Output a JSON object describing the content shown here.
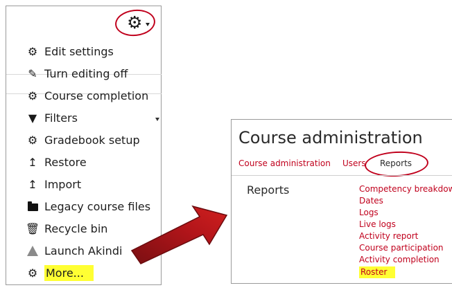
{
  "menu": {
    "gear_icon": "gear-icon",
    "items": [
      {
        "label": "Edit settings",
        "icon": "gear-icon"
      },
      {
        "label": "Turn editing off",
        "icon": "pencil-icon"
      },
      {
        "label": "Course completion",
        "icon": "gear-icon"
      },
      {
        "label": "Filters",
        "icon": "filter-icon"
      },
      {
        "label": "Gradebook setup",
        "icon": "gear-icon"
      },
      {
        "label": "Restore",
        "icon": "upload-icon"
      },
      {
        "label": "Import",
        "icon": "upload-icon"
      },
      {
        "label": "Legacy course files",
        "icon": "folder-icon"
      },
      {
        "label": "Recycle bin",
        "icon": "trash-icon"
      },
      {
        "label": "Launch Akindi",
        "icon": "triangle-icon"
      },
      {
        "label": "More...",
        "icon": "gear-icon"
      }
    ],
    "highlight_color": "#ffff33"
  },
  "admin": {
    "title": "Course administration",
    "tabs": [
      {
        "label": "Course administration"
      },
      {
        "label": "Users"
      },
      {
        "label": "Reports"
      }
    ],
    "section_heading": "Reports",
    "links": [
      "Competency breakdown",
      "Dates",
      "Logs",
      "Live logs",
      "Activity report",
      "Course participation",
      "Activity completion",
      "Roster"
    ],
    "link_color": "#c0001c",
    "annotation_color": "#c0001c"
  }
}
